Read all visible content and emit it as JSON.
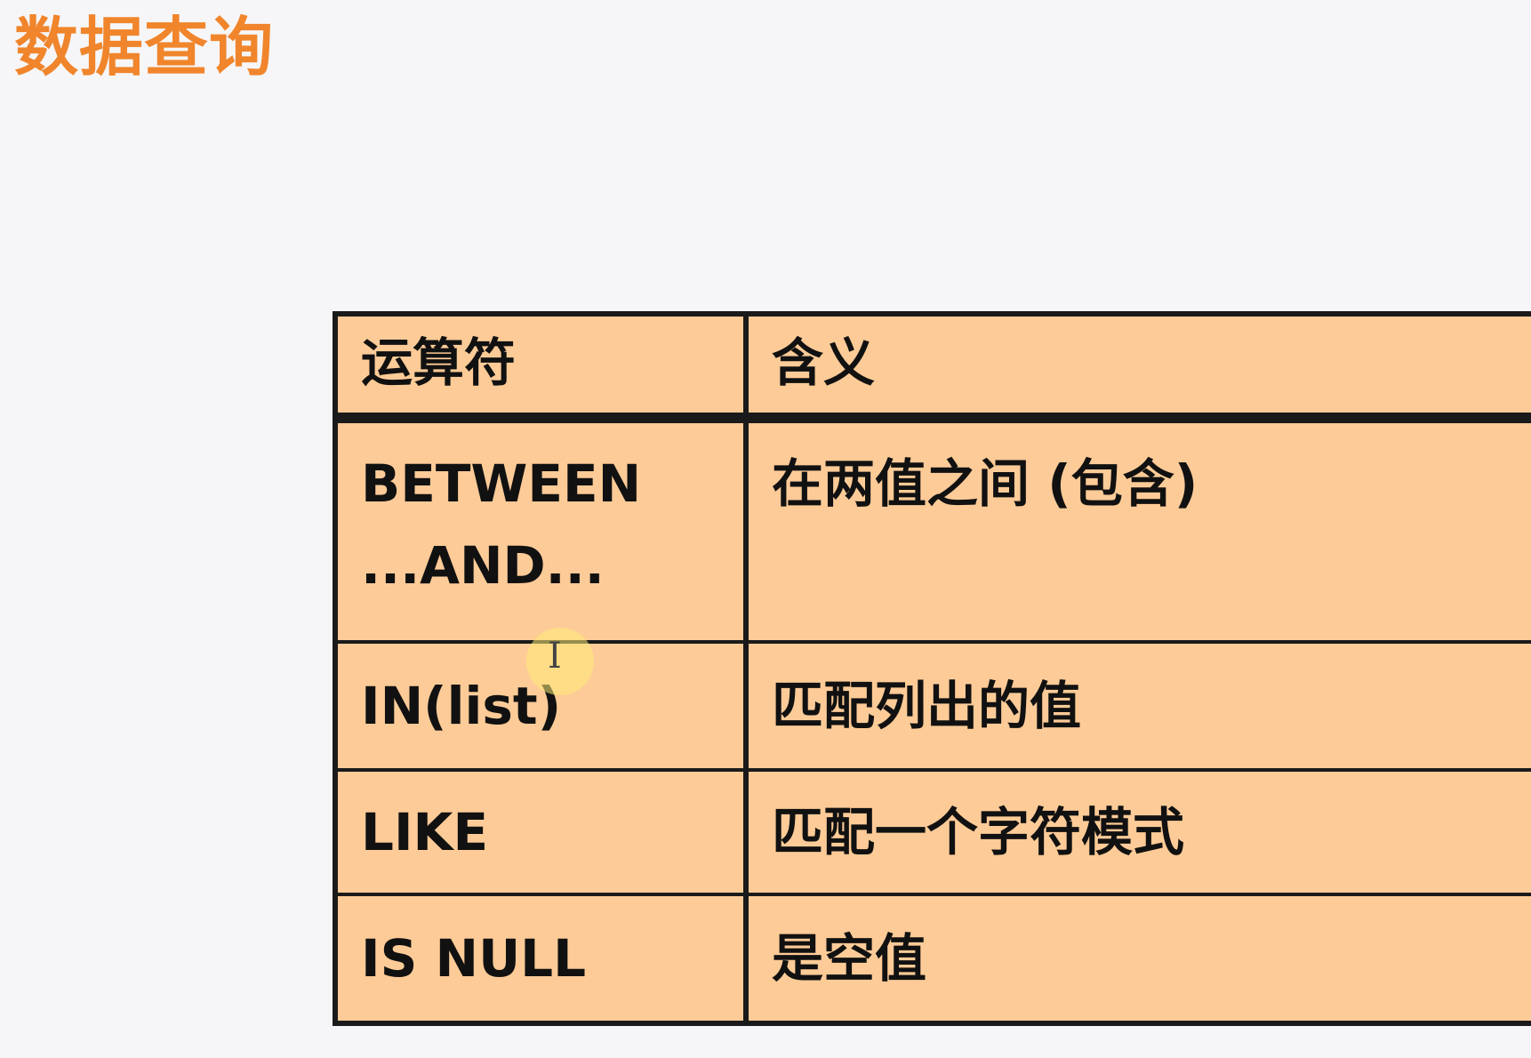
{
  "title": "数据查询",
  "table": {
    "headers": {
      "operator": "运算符",
      "meaning": "含义"
    },
    "rows": [
      {
        "operator_line1": "BETWEEN",
        "operator_line2": "...AND...",
        "meaning": "在两值之间 (包含)"
      },
      {
        "operator": "IN(list)",
        "meaning": "匹配列出的值"
      },
      {
        "operator": "LIKE",
        "meaning": "匹配一个字符模式"
      },
      {
        "operator": "IS NULL",
        "meaning": "是空值"
      }
    ]
  },
  "cursor": {
    "glyph": "I",
    "icon": "text-cursor-icon",
    "highlight_color": "#ffec78"
  },
  "colors": {
    "title": "#f0852c",
    "table_fill": "#fdcb97",
    "border": "#1a1a1a",
    "background": "#f6f6f8"
  }
}
